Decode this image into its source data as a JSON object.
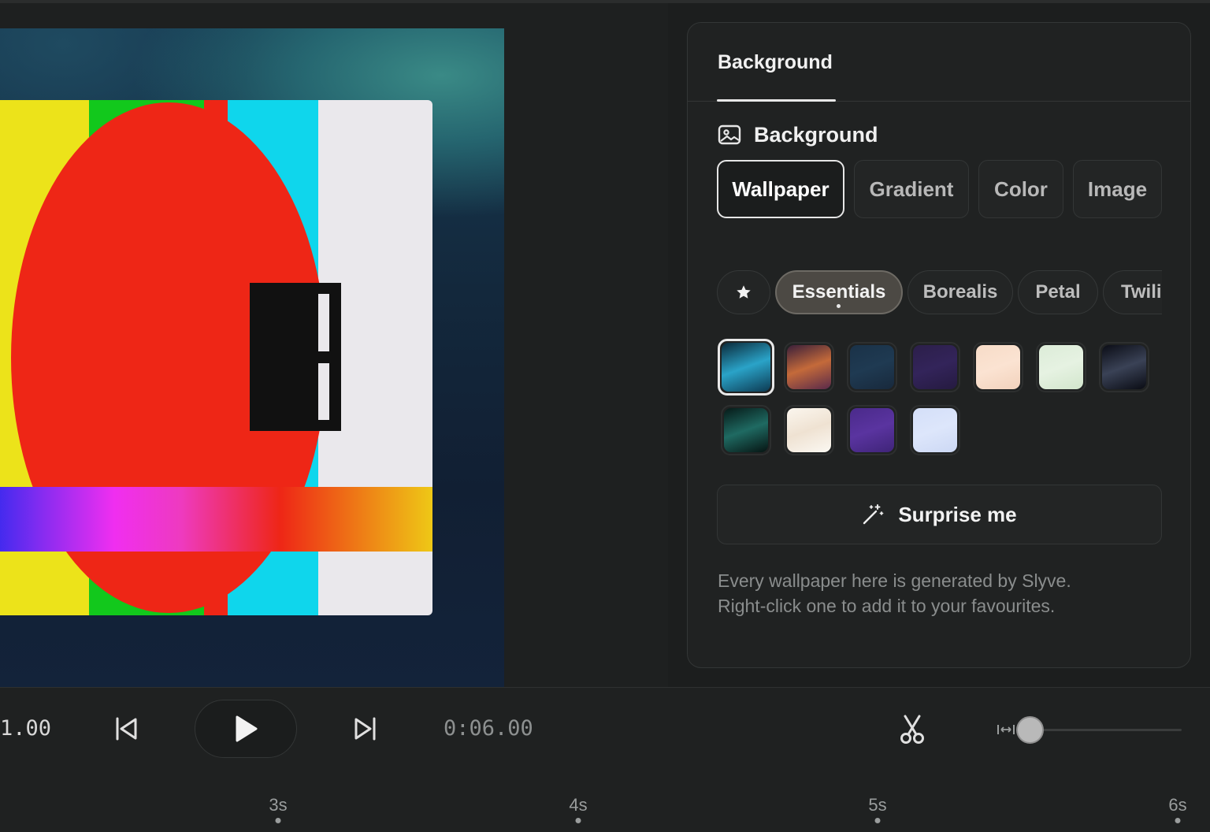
{
  "panel": {
    "tab_label": "Background",
    "section_title": "Background",
    "type_buttons": [
      "Wallpaper",
      "Gradient",
      "Color",
      "Image"
    ],
    "active_type": "Wallpaper",
    "categories": [
      "Essentials",
      "Borealis",
      "Petal",
      "Twilight"
    ],
    "active_category": "Essentials",
    "favourites_icon": "star-icon",
    "swatches": [
      {
        "colors": [
          "#0b2a3a",
          "#2aa3c8",
          "#0d3a52"
        ],
        "selected": true
      },
      {
        "colors": [
          "#3a1f3a",
          "#c46a3a",
          "#5a2a4a"
        ],
        "selected": false
      },
      {
        "colors": [
          "#1a3248",
          "#1f3a52",
          "#18293c"
        ],
        "selected": false
      },
      {
        "colors": [
          "#2c1f4a",
          "#33245a",
          "#251a40"
        ],
        "selected": false
      },
      {
        "colors": [
          "#f7dcc8",
          "#fbe3d2",
          "#f2d2bc"
        ],
        "selected": false
      },
      {
        "colors": [
          "#dcecd8",
          "#e6f2e2",
          "#d2e6cc"
        ],
        "selected": false
      },
      {
        "colors": [
          "#0b0d16",
          "#3a4256",
          "#0a0c14"
        ],
        "selected": false
      },
      {
        "colors": [
          "#061a18",
          "#1f6a62",
          "#061412"
        ],
        "selected": false
      },
      {
        "colors": [
          "#fbf6ee",
          "#efe2d2",
          "#fbf8f2"
        ],
        "selected": false
      },
      {
        "colors": [
          "#4a2a8a",
          "#5a34a0",
          "#3f2478"
        ],
        "selected": false
      },
      {
        "colors": [
          "#d4dff8",
          "#dde6fb",
          "#ccd8f4"
        ],
        "selected": false
      }
    ],
    "surprise_label": "Surprise me",
    "help_line1": "Every wallpaper here is generated by Slyve.",
    "help_line2": "Right-click one to add it to your favourites."
  },
  "transport": {
    "current_time": "1.00",
    "total_time": "0:06.00"
  },
  "ruler": {
    "ticks": [
      "3s",
      "4s",
      "5s",
      "6s"
    ]
  },
  "colors": {
    "accent": "#e6e6e6",
    "panel_bg": "#202222",
    "app_bg": "#1c1e1e"
  }
}
